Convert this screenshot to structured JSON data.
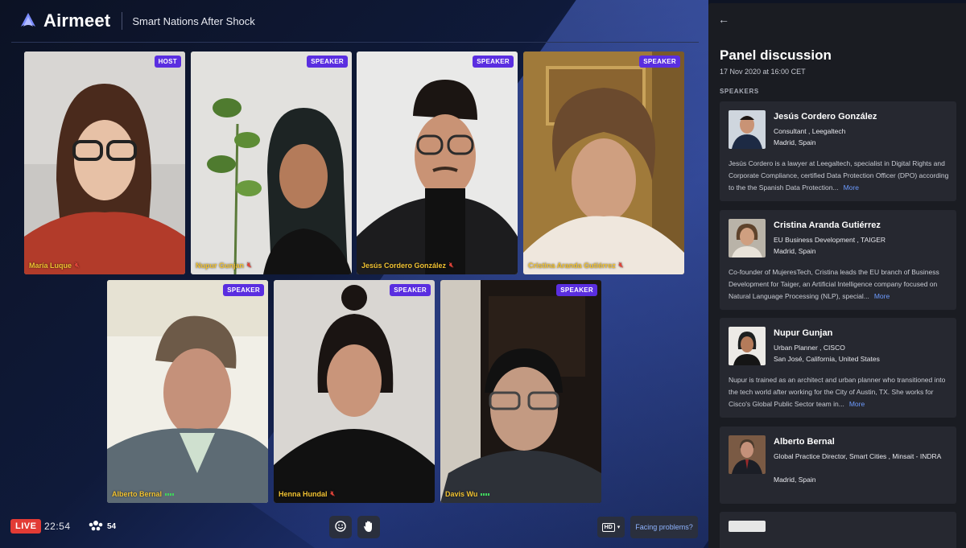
{
  "app": {
    "logo_text": "Airmeet",
    "event_title": "Smart Nations After Shock"
  },
  "colors": {
    "badge": "#5a2ee0",
    "name": "#f1c232",
    "live": "#e23b35",
    "mic_off": "#e0443a",
    "link": "#6d9bff"
  },
  "tiles": [
    {
      "name": "María Luque",
      "badge": "HOST",
      "audio": "muted"
    },
    {
      "name": "Nupur Gunjan",
      "badge": "SPEAKER",
      "audio": "muted"
    },
    {
      "name": "Jesús Cordero González",
      "badge": "SPEAKER",
      "audio": "muted"
    },
    {
      "name": "Cristina Aranda Gutiérrez",
      "badge": "SPEAKER",
      "audio": "muted"
    },
    {
      "name": "Alberto Bernal",
      "badge": "SPEAKER",
      "audio": "speaking"
    },
    {
      "name": "Henna Hundal",
      "badge": "SPEAKER",
      "audio": "muted"
    },
    {
      "name": "Davis Wu",
      "badge": "SPEAKER",
      "audio": "speaking"
    }
  ],
  "bottom": {
    "live_label": "LIVE",
    "timer": "22:54",
    "attendee_count": "54",
    "emoji_icon": "smiley-icon",
    "hand_icon": "raise-hand-icon",
    "hd_label": "HD",
    "facing_problems": "Facing problems?"
  },
  "panel": {
    "title": "Panel discussion",
    "date": "17 Nov 2020 at 16:00 CET",
    "section_label": "SPEAKERS",
    "more_label": "More",
    "speakers": [
      {
        "name": "Jesús Cordero González",
        "role": "Consultant , Leegaltech",
        "location": "Madrid, Spain",
        "bio": "Jesús Cordero is a lawyer at Leegaltech, specialist in Digital Rights and Corporate Compliance, certified Data Protection Officer (DPO) according to the the Spanish Data Protection..."
      },
      {
        "name": "Cristina Aranda Gutiérrez",
        "role": "EU Business Development , TAIGER",
        "location": "Madrid, Spain",
        "bio": "Co-founder of MujeresTech, Cristina leads the EU branch of Business Development for Taiger, an Artificial Intelligence company focused on Natural Language Processing (NLP), special..."
      },
      {
        "name": "Nupur Gunjan",
        "role": "Urban Planner , CISCO",
        "location": "San José, California, United States",
        "bio": "Nupur is trained as an architect and urban planner who transitioned into the tech world after working for the City of Austin, TX. She works for Cisco's Global Public Sector team in..."
      },
      {
        "name": "Alberto Bernal",
        "role": "Global Practice Director, Smart Cities , Minsait - INDRA",
        "location": "Madrid, Spain",
        "bio": ""
      }
    ]
  }
}
